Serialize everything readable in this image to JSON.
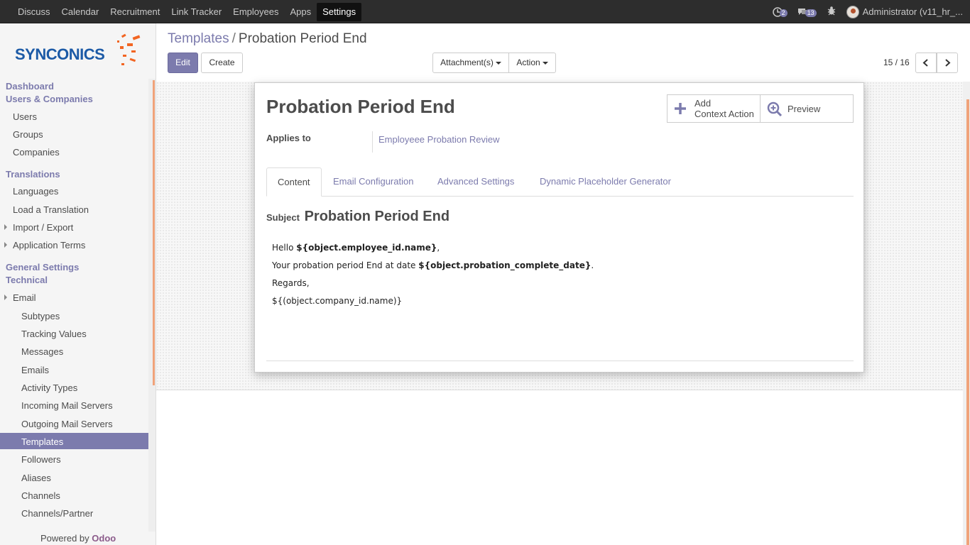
{
  "topbar": {
    "menu": [
      "Discuss",
      "Calendar",
      "Recruitment",
      "Link Tracker",
      "Employees",
      "Apps",
      "Settings"
    ],
    "active_menu": "Settings",
    "activity_count": "2",
    "message_count": "13",
    "user_name": "Administrator (v11_hr_..."
  },
  "logo": {
    "text": "SYNCONICS"
  },
  "sidebar": {
    "dashboard": "Dashboard",
    "users_companies": "Users & Companies",
    "users": "Users",
    "groups": "Groups",
    "companies": "Companies",
    "translations": "Translations",
    "languages": "Languages",
    "load_translation": "Load a Translation",
    "import_export": "Import / Export",
    "application_terms": "Application Terms",
    "general_settings": "General Settings",
    "technical": "Technical",
    "email": "Email",
    "subtypes": "Subtypes",
    "tracking_values": "Tracking Values",
    "messages": "Messages",
    "emails": "Emails",
    "activity_types": "Activity Types",
    "incoming_mail": "Incoming Mail Servers",
    "outgoing_mail": "Outgoing Mail Servers",
    "templates": "Templates",
    "followers": "Followers",
    "aliases": "Aliases",
    "channels": "Channels",
    "channels_partner": "Channels/Partner",
    "powered_by": "Powered by",
    "powered_brand": "Odoo"
  },
  "breadcrumb": {
    "parent": "Templates",
    "separator": "/",
    "current": "Probation Period End"
  },
  "buttons": {
    "edit": "Edit",
    "create": "Create",
    "attachments": "Attachment(s)",
    "action": "Action"
  },
  "pager": {
    "value": "15 / 16"
  },
  "form": {
    "title": "Probation Period End",
    "smart_add_line1": "Add",
    "smart_add_line2": "Context Action",
    "smart_preview": "Preview",
    "applies_to_label": "Applies to",
    "applies_to_value": "Employeee Probation Review",
    "tabs": [
      "Content",
      "Email Configuration",
      "Advanced Settings",
      "Dynamic Placeholder Generator"
    ],
    "subject_label": "Subject",
    "subject_value": "Probation Period End",
    "body": {
      "hello": "Hello ",
      "employee_placeholder": "${object.employee_id.name}",
      "comma": ",",
      "probation_text": "Your probation period End at date ",
      "date_placeholder": "${object.probation_complete_date}",
      "period": ".",
      "regards": "Regards,",
      "company_placeholder": "${(object.company_id.name)}"
    }
  },
  "colors": {
    "brand": "#7c7bad",
    "topbar": "#2d2d2d",
    "accent_scroll": "#f0a37a",
    "logo_blue": "#1c5aa6",
    "logo_orange": "#f26522"
  }
}
